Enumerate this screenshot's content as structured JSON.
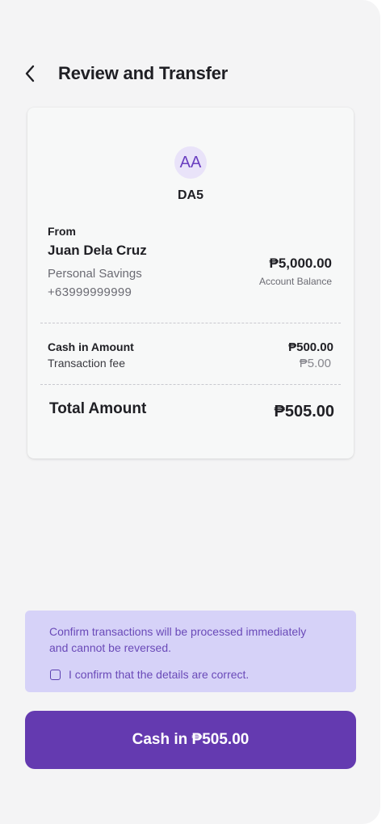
{
  "header": {
    "title": "Review and Transfer",
    "back_icon": "chevron-left-icon"
  },
  "recipient": {
    "initials": "AA",
    "name": "DA5"
  },
  "from": {
    "label": "From",
    "name": "Juan Dela Cruz",
    "account_type": "Personal Savings",
    "phone": "+63999999999",
    "balance": "₱5,000.00",
    "balance_label": "Account Balance"
  },
  "breakdown": {
    "amount_label": "Cash in Amount",
    "amount_value": "₱500.00",
    "fee_label": "Transaction fee",
    "fee_value": "₱5.00",
    "total_label": "Total Amount",
    "total_value": "₱505.00"
  },
  "notice": {
    "text": "Confirm transactions will be processed immediately and cannot be reversed.",
    "confirm_label": "I confirm that the details are correct.",
    "confirm_checked": false
  },
  "cta": {
    "label": "Cash in ₱505.00"
  },
  "colors": {
    "accent": "#643ab0",
    "notice_bg": "#d6d2f8",
    "avatar_bg": "#e9e3f9",
    "screen_bg": "#f4f4f5"
  }
}
